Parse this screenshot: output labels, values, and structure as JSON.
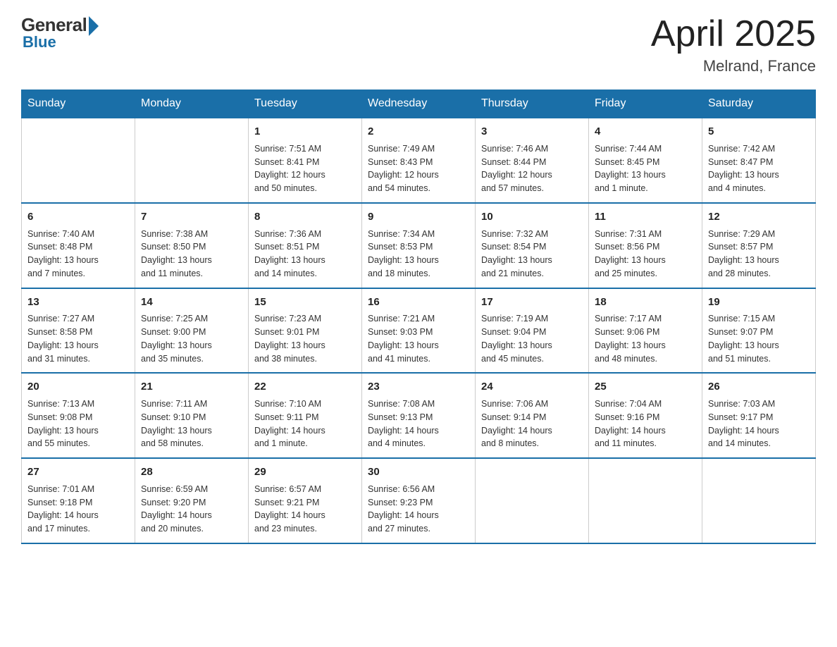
{
  "header": {
    "logo_general": "General",
    "logo_blue": "Blue",
    "title": "April 2025",
    "subtitle": "Melrand, France"
  },
  "days_of_week": [
    "Sunday",
    "Monday",
    "Tuesday",
    "Wednesday",
    "Thursday",
    "Friday",
    "Saturday"
  ],
  "weeks": [
    [
      {
        "day": "",
        "info": ""
      },
      {
        "day": "",
        "info": ""
      },
      {
        "day": "1",
        "info": "Sunrise: 7:51 AM\nSunset: 8:41 PM\nDaylight: 12 hours\nand 50 minutes."
      },
      {
        "day": "2",
        "info": "Sunrise: 7:49 AM\nSunset: 8:43 PM\nDaylight: 12 hours\nand 54 minutes."
      },
      {
        "day": "3",
        "info": "Sunrise: 7:46 AM\nSunset: 8:44 PM\nDaylight: 12 hours\nand 57 minutes."
      },
      {
        "day": "4",
        "info": "Sunrise: 7:44 AM\nSunset: 8:45 PM\nDaylight: 13 hours\nand 1 minute."
      },
      {
        "day": "5",
        "info": "Sunrise: 7:42 AM\nSunset: 8:47 PM\nDaylight: 13 hours\nand 4 minutes."
      }
    ],
    [
      {
        "day": "6",
        "info": "Sunrise: 7:40 AM\nSunset: 8:48 PM\nDaylight: 13 hours\nand 7 minutes."
      },
      {
        "day": "7",
        "info": "Sunrise: 7:38 AM\nSunset: 8:50 PM\nDaylight: 13 hours\nand 11 minutes."
      },
      {
        "day": "8",
        "info": "Sunrise: 7:36 AM\nSunset: 8:51 PM\nDaylight: 13 hours\nand 14 minutes."
      },
      {
        "day": "9",
        "info": "Sunrise: 7:34 AM\nSunset: 8:53 PM\nDaylight: 13 hours\nand 18 minutes."
      },
      {
        "day": "10",
        "info": "Sunrise: 7:32 AM\nSunset: 8:54 PM\nDaylight: 13 hours\nand 21 minutes."
      },
      {
        "day": "11",
        "info": "Sunrise: 7:31 AM\nSunset: 8:56 PM\nDaylight: 13 hours\nand 25 minutes."
      },
      {
        "day": "12",
        "info": "Sunrise: 7:29 AM\nSunset: 8:57 PM\nDaylight: 13 hours\nand 28 minutes."
      }
    ],
    [
      {
        "day": "13",
        "info": "Sunrise: 7:27 AM\nSunset: 8:58 PM\nDaylight: 13 hours\nand 31 minutes."
      },
      {
        "day": "14",
        "info": "Sunrise: 7:25 AM\nSunset: 9:00 PM\nDaylight: 13 hours\nand 35 minutes."
      },
      {
        "day": "15",
        "info": "Sunrise: 7:23 AM\nSunset: 9:01 PM\nDaylight: 13 hours\nand 38 minutes."
      },
      {
        "day": "16",
        "info": "Sunrise: 7:21 AM\nSunset: 9:03 PM\nDaylight: 13 hours\nand 41 minutes."
      },
      {
        "day": "17",
        "info": "Sunrise: 7:19 AM\nSunset: 9:04 PM\nDaylight: 13 hours\nand 45 minutes."
      },
      {
        "day": "18",
        "info": "Sunrise: 7:17 AM\nSunset: 9:06 PM\nDaylight: 13 hours\nand 48 minutes."
      },
      {
        "day": "19",
        "info": "Sunrise: 7:15 AM\nSunset: 9:07 PM\nDaylight: 13 hours\nand 51 minutes."
      }
    ],
    [
      {
        "day": "20",
        "info": "Sunrise: 7:13 AM\nSunset: 9:08 PM\nDaylight: 13 hours\nand 55 minutes."
      },
      {
        "day": "21",
        "info": "Sunrise: 7:11 AM\nSunset: 9:10 PM\nDaylight: 13 hours\nand 58 minutes."
      },
      {
        "day": "22",
        "info": "Sunrise: 7:10 AM\nSunset: 9:11 PM\nDaylight: 14 hours\nand 1 minute."
      },
      {
        "day": "23",
        "info": "Sunrise: 7:08 AM\nSunset: 9:13 PM\nDaylight: 14 hours\nand 4 minutes."
      },
      {
        "day": "24",
        "info": "Sunrise: 7:06 AM\nSunset: 9:14 PM\nDaylight: 14 hours\nand 8 minutes."
      },
      {
        "day": "25",
        "info": "Sunrise: 7:04 AM\nSunset: 9:16 PM\nDaylight: 14 hours\nand 11 minutes."
      },
      {
        "day": "26",
        "info": "Sunrise: 7:03 AM\nSunset: 9:17 PM\nDaylight: 14 hours\nand 14 minutes."
      }
    ],
    [
      {
        "day": "27",
        "info": "Sunrise: 7:01 AM\nSunset: 9:18 PM\nDaylight: 14 hours\nand 17 minutes."
      },
      {
        "day": "28",
        "info": "Sunrise: 6:59 AM\nSunset: 9:20 PM\nDaylight: 14 hours\nand 20 minutes."
      },
      {
        "day": "29",
        "info": "Sunrise: 6:57 AM\nSunset: 9:21 PM\nDaylight: 14 hours\nand 23 minutes."
      },
      {
        "day": "30",
        "info": "Sunrise: 6:56 AM\nSunset: 9:23 PM\nDaylight: 14 hours\nand 27 minutes."
      },
      {
        "day": "",
        "info": ""
      },
      {
        "day": "",
        "info": ""
      },
      {
        "day": "",
        "info": ""
      }
    ]
  ]
}
